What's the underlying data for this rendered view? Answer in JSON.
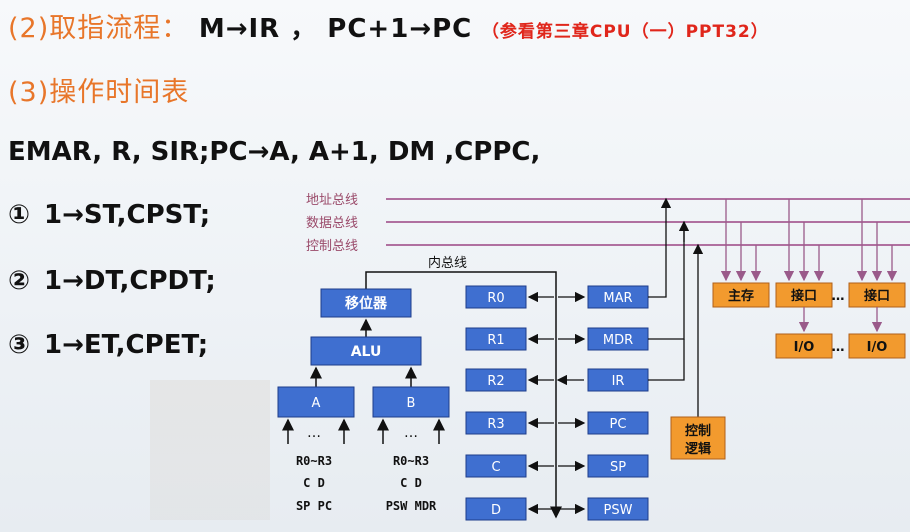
{
  "title1": {
    "label": "(2)取指流程：",
    "flow": "M→IR ， PC+1→PC",
    "ref": "（参看第三章CPU（一）PPT32）"
  },
  "title2": {
    "label": "(3)操作时间表"
  },
  "ops_line": "EMAR, R, SIR;PC→A, A+1, DM ,CPPC,",
  "steps": [
    {
      "num": "①",
      "text": "1→ST,CPST;"
    },
    {
      "num": "②",
      "text": "1→DT,CPDT;"
    },
    {
      "num": "③",
      "text": "1→ET,CPET;"
    }
  ],
  "diagram": {
    "bus_labels": [
      "地址总线",
      "数据总线",
      "控制总线"
    ],
    "internal_bus": "内总线",
    "shifter": "移位器",
    "alu": "ALU",
    "a": "A",
    "b": "B",
    "dots": "…",
    "a_inputs": [
      "R0~R3",
      "C  D",
      "SP  PC"
    ],
    "b_inputs": [
      "R0~R3",
      "C  D",
      "PSW MDR"
    ],
    "registers": [
      "R0",
      "R1",
      "R2",
      "R3",
      "C",
      "D"
    ],
    "special": [
      "MAR",
      "MDR",
      "IR",
      "PC",
      "SP",
      "PSW"
    ],
    "control": [
      "控制",
      "逻辑"
    ],
    "memory": "主存",
    "interface": "接口",
    "io": "I/O",
    "colors": {
      "blue_box": "#3f6fd0",
      "orange_box": "#f29a2e",
      "bus_line": "#b070a0",
      "arrow": "#111111"
    }
  }
}
